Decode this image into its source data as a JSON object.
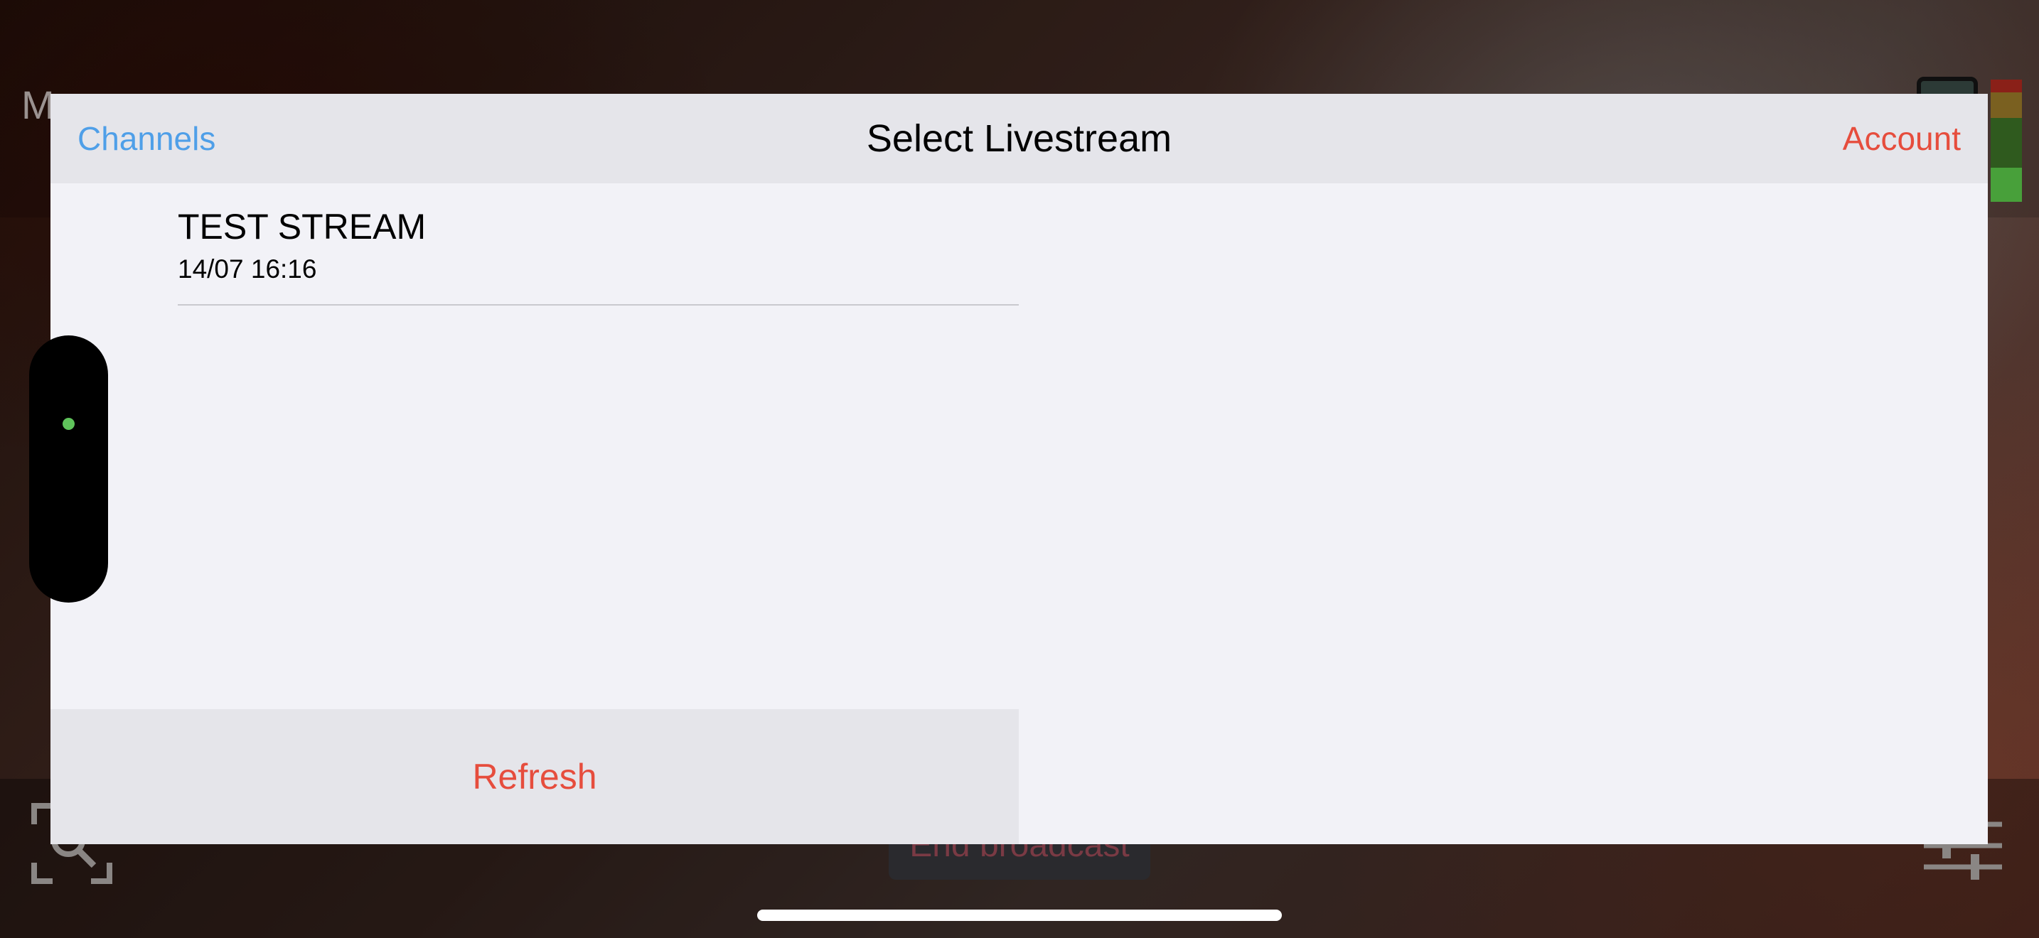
{
  "background": {
    "title": "M",
    "end_button_label": "End broadcast",
    "level_meter_colors": [
      "#b02a1a",
      "#8a6a1a",
      "#3a6a20",
      "#2a5a18",
      "#4aa03a"
    ]
  },
  "nav": {
    "left_label": "Channels",
    "title": "Select Livestream",
    "right_label": "Account"
  },
  "streams": [
    {
      "title": "TEST STREAM",
      "date": "14/07 16:16"
    }
  ],
  "refresh_label": "Refresh",
  "colors": {
    "nav_link": "#4f9fe8",
    "destructive": "#e64d3d",
    "status_dot": "#5fc45b"
  }
}
